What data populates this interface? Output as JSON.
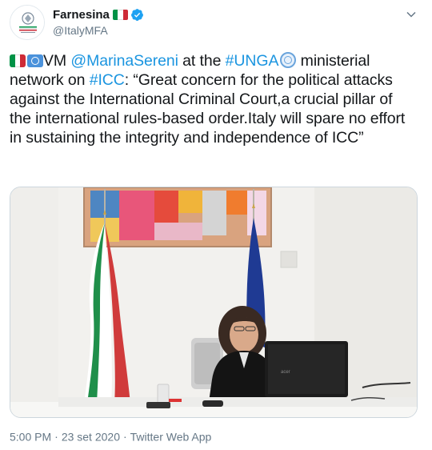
{
  "account": {
    "display_name": "Farnesina",
    "handle": "@ItalyMFA",
    "verified": true,
    "flag": "italian-flag-icon"
  },
  "tweet": {
    "lead_text": "VM ",
    "mention": "@MarinaSereni",
    "text_after_mention": " at the ",
    "hashtag_unga": "#UNGA",
    "text_after_unga": " ministerial network on ",
    "hashtag_icc": "#ICC",
    "quote": ": “Great concern for the political attacks against the International Criminal Court,a crucial pillar of the international rules-based order.Italy will spare no effort in sustaining the integrity and independence of ICC”"
  },
  "meta": {
    "time": "5:00 PM",
    "date": "23 set 2020",
    "source": "Twitter Web App"
  },
  "colors": {
    "link": "#1b95e0",
    "verified_badge": "#1da1f2",
    "italy_green": "#009246",
    "italy_white": "#ffffff",
    "italy_red": "#ce2b37",
    "eu_blue": "#1f3a93",
    "un_blue": "#4b92db"
  }
}
